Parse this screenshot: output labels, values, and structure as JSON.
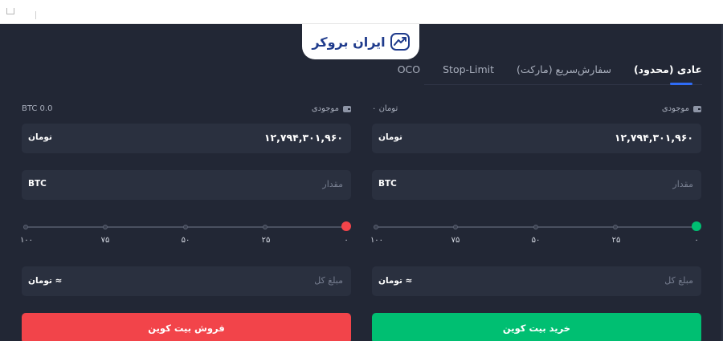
{
  "brand": {
    "name": "ایران بروکر",
    "color": "#1f3b8c",
    "icon": "chart-trend-icon"
  },
  "tabs": [
    {
      "label": "عادی (محدود)",
      "active": true
    },
    {
      "label": "سفارش‌سریع (مارکت)",
      "active": false
    },
    {
      "label": "Stop-Limit",
      "active": false
    },
    {
      "label": "OCO",
      "active": false
    }
  ],
  "buy": {
    "balance_label": "موجودی",
    "balance_value": "۰ تومان",
    "price_value": "۱۲,۷۹۴,۳۰۱,۹۶۰",
    "price_unit": "تومان",
    "amount_placeholder": "مقدار",
    "amount_unit": "BTC",
    "slider_labels": [
      "۰",
      "۲۵",
      "۵۰",
      "۷۵",
      "۱۰۰"
    ],
    "slider_percent": 0,
    "total_placeholder": "مبلغ کل",
    "total_unit": "≈ تومان",
    "button_label": "خرید بیت کوین",
    "color": "#00bf72"
  },
  "sell": {
    "balance_label": "موجودی",
    "balance_value": "BTC 0.0",
    "price_value": "۱۲,۷۹۴,۳۰۱,۹۶۰",
    "price_unit": "تومان",
    "amount_placeholder": "مقدار",
    "amount_unit": "BTC",
    "slider_labels": [
      "۰",
      "۲۵",
      "۵۰",
      "۷۵",
      "۱۰۰"
    ],
    "slider_percent": 0,
    "total_placeholder": "مبلغ کل",
    "total_unit": "≈ تومان",
    "button_label": "فروش بیت کوین",
    "color": "#f2444a"
  }
}
